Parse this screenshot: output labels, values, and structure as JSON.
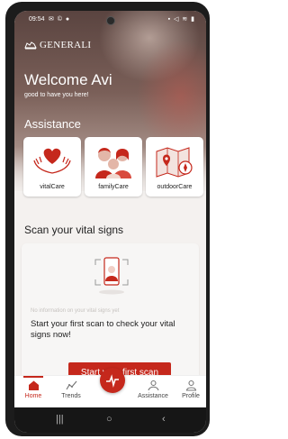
{
  "status_bar": {
    "time": "09:54",
    "left_icons": "✉ © ●",
    "right_icons": "▪ ◁ ≋ ▮"
  },
  "brand": {
    "name": "GENERALI",
    "color": "#c5281c"
  },
  "hero": {
    "welcome": "Welcome Avi",
    "subtitle": "good to have you here!"
  },
  "assistance": {
    "title": "Assistance",
    "cards": [
      {
        "label": "vitalCare",
        "icon": "heart-hands-icon"
      },
      {
        "label": "familyCare",
        "icon": "family-icon"
      },
      {
        "label": "outdoorCare",
        "icon": "map-compass-icon"
      }
    ]
  },
  "scan": {
    "title": "Scan your vital signs",
    "no_info": "No information on your vital signs yet",
    "cta": "Start your first scan to check your vital signs now!",
    "button": "Start your first scan"
  },
  "nav": {
    "items": [
      {
        "label": "Home",
        "icon": "home-icon",
        "active": true
      },
      {
        "label": "Trends",
        "icon": "trends-icon",
        "active": false
      },
      {
        "label": "Assistance",
        "icon": "assistance-icon",
        "active": false
      },
      {
        "label": "Profile",
        "icon": "profile-icon",
        "active": false
      }
    ],
    "center_icon": "heartbeat-icon"
  },
  "system_nav": {
    "recents": "|||",
    "home": "○",
    "back": "‹"
  }
}
